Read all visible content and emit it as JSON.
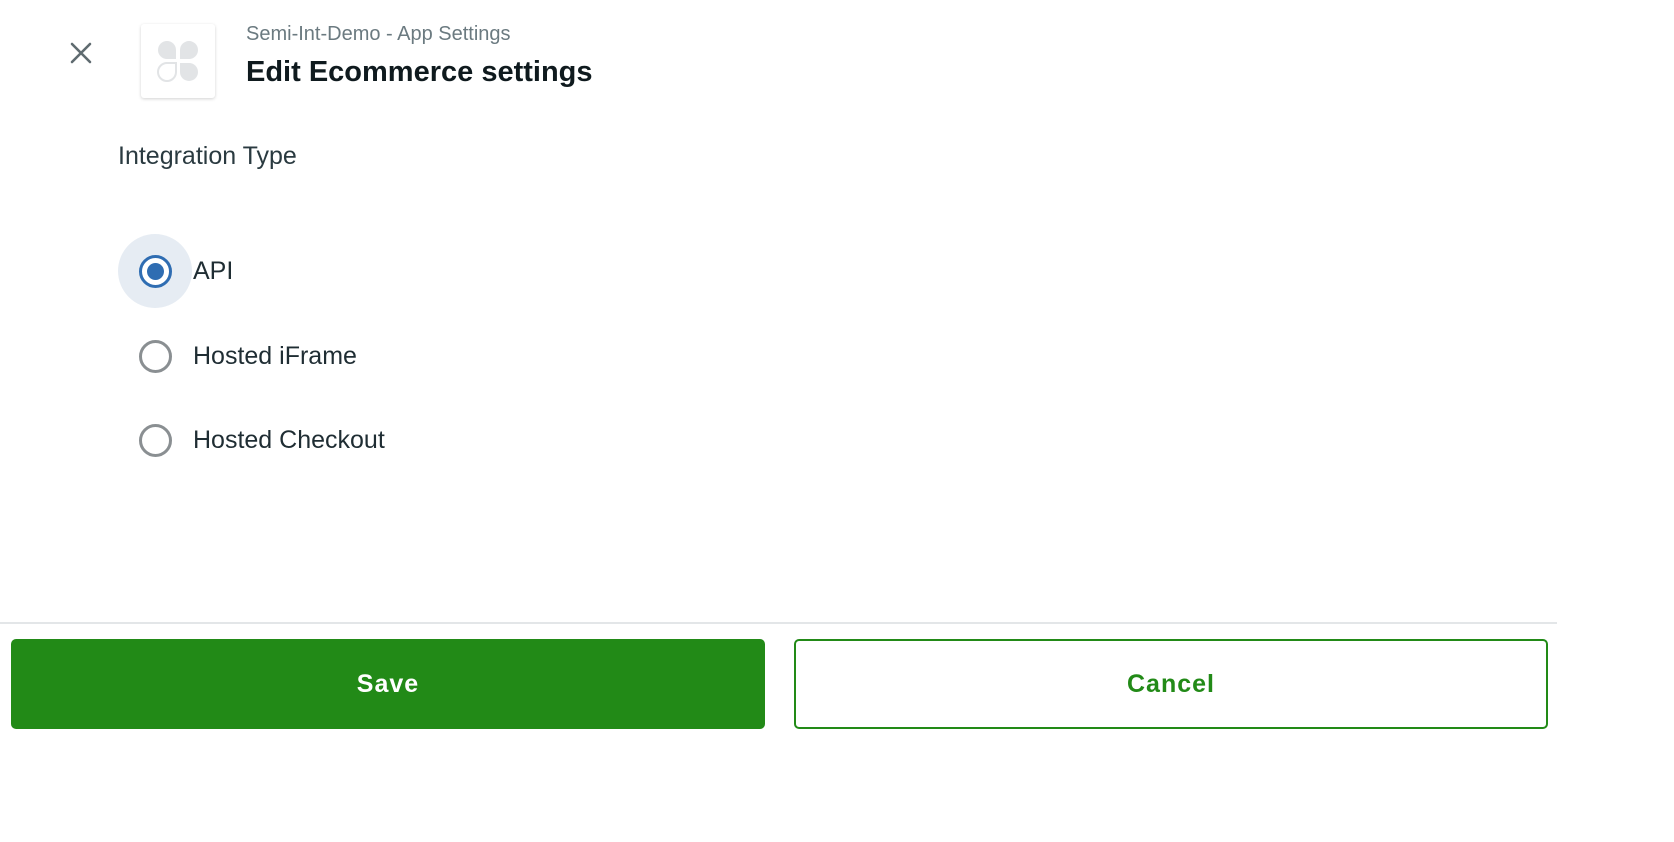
{
  "header": {
    "breadcrumb": "Semi-Int-Demo - App Settings",
    "title": "Edit Ecommerce settings",
    "close_icon": "close-icon",
    "logo_icon": "app-logo-icon"
  },
  "form": {
    "section_label": "Integration Type",
    "options": [
      {
        "label": "API",
        "selected": true
      },
      {
        "label": "Hosted iFrame",
        "selected": false
      },
      {
        "label": "Hosted Checkout",
        "selected": false
      }
    ]
  },
  "footer": {
    "save_label": "Save",
    "cancel_label": "Cancel"
  },
  "colors": {
    "primary_green": "#228a17",
    "radio_selected": "#2f6db2",
    "radio_halo": "#e6ecf3"
  }
}
